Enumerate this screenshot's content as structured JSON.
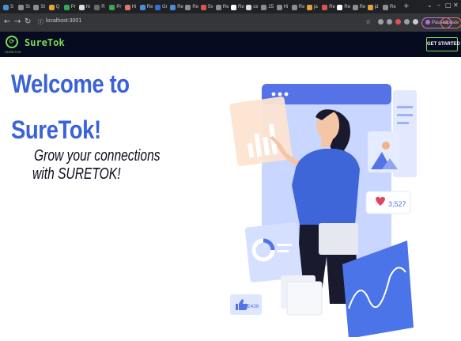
{
  "browser": {
    "url": "localhost:3001",
    "paused_label": "Paused",
    "update_label": "Update",
    "tabs": [
      {
        "label": "S",
        "color": "#4a90d9"
      },
      {
        "label": "St",
        "color": "#8e8e8e"
      },
      {
        "label": "St",
        "color": "#8e8e8e"
      },
      {
        "label": "Q",
        "color": "#e8a23c"
      },
      {
        "label": "Pr",
        "color": "#3aa757"
      },
      {
        "label": "ht",
        "color": "#dddddd"
      },
      {
        "label": "R",
        "color": "#6b6b6b"
      },
      {
        "label": "Pr",
        "color": "#3aa757"
      },
      {
        "label": "Hi",
        "color": "#e57373"
      },
      {
        "label": "Re",
        "color": "#4a90d9"
      },
      {
        "label": "Gr",
        "color": "#2f6fd6"
      },
      {
        "label": "Re",
        "color": "#4a90d9"
      },
      {
        "label": "Re",
        "color": "#8e8e8e"
      },
      {
        "label": "Sv",
        "color": "#e05252"
      },
      {
        "label": "Re",
        "color": "#8e8e8e"
      },
      {
        "label": "Re",
        "color": "#ffffff"
      },
      {
        "label": "ce",
        "color": "#dddddd"
      },
      {
        "label": "25",
        "color": "#8e8e8e"
      },
      {
        "label": "Hi",
        "color": "#8e8e8e"
      },
      {
        "label": "Re",
        "color": "#8e8e8e"
      },
      {
        "label": "ja",
        "color": "#e8a23c"
      },
      {
        "label": "Re",
        "color": "#e05252"
      },
      {
        "label": "Re",
        "color": "#ffffff"
      },
      {
        "label": "Re",
        "color": "#8e8e8e"
      },
      {
        "label": "jd",
        "color": "#e8a23c"
      },
      {
        "label": "Re",
        "color": "#8e8e8e"
      }
    ]
  },
  "app": {
    "brand": "SureTok",
    "logo_caption": "SURETOK",
    "cta_label": "GET STARTED",
    "accent_color": "#7ed957",
    "nav_bg": "#070b20"
  },
  "hero": {
    "line1": "Welcome to",
    "line2": "SureTok!",
    "tagline1": "Grow your connections",
    "tagline2": "with SURETOK!",
    "heading_color": "#3b63d8"
  },
  "illustration": {
    "likes_count": "3,527",
    "thumbs_count": "2436"
  }
}
